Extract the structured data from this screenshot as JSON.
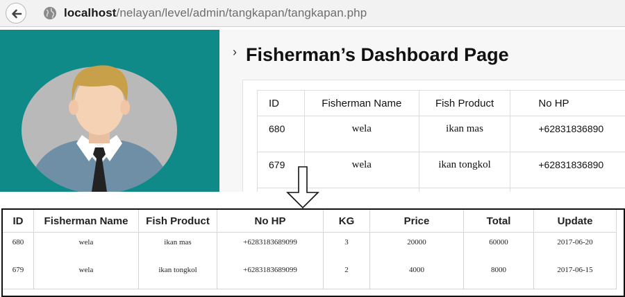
{
  "browser": {
    "url_host": "localhost",
    "url_path": "/nelayan/level/admin/tangkapan/tangkapan.php"
  },
  "page": {
    "title": "Fisherman’s Dashboard Page",
    "title_chevron": "›"
  },
  "colors": {
    "sidebar": "#0f8a88",
    "avatar_circle": "#b9b9b9",
    "hair": "#c9a04a",
    "skin": "#f5d2b4",
    "jacket": "#6f8fa6",
    "tie": "#222222"
  },
  "top_table": {
    "headers": [
      "ID",
      "Fisherman Name",
      "Fish Product",
      "No HP"
    ],
    "rows": [
      {
        "id": "680",
        "name": "wela",
        "fish": "ikan mas",
        "hp": "+62831836890"
      },
      {
        "id": "679",
        "name": "wela",
        "fish": "ikan tongkol",
        "hp": "+62831836890"
      }
    ]
  },
  "zoom_table": {
    "headers": [
      "ID",
      "Fisherman Name",
      "Fish Product",
      "No HP",
      "KG",
      "Price",
      "Total",
      "Update"
    ],
    "rows": [
      {
        "id": "680",
        "name": "wela",
        "fish": "ikan mas",
        "hp": "+6283183689099",
        "kg": "3",
        "price": "20000",
        "total": "60000",
        "update": "2017-06-20"
      },
      {
        "id": "679",
        "name": "wela",
        "fish": "ikan tongkol",
        "hp": "+6283183689099",
        "kg": "2",
        "price": "4000",
        "total": "8000",
        "update": "2017-06-15"
      }
    ]
  },
  "icons": {
    "back": "back-arrow-icon",
    "site": "globe-icon",
    "avatar": "user-avatar",
    "arrow": "down-arrow-icon"
  }
}
